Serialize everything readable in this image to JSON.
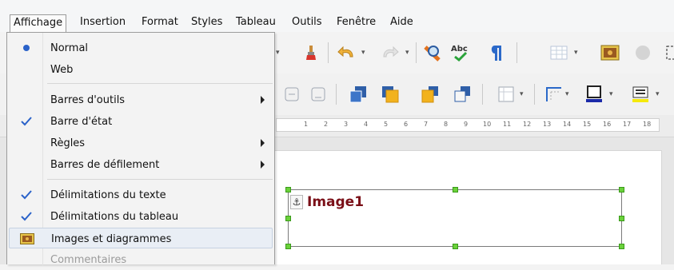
{
  "menubar": {
    "items": [
      "Affichage",
      "Insertion",
      "Format",
      "Styles",
      "Tableau",
      "Outils",
      "Fenêtre",
      "Aide"
    ]
  },
  "menu": {
    "items": [
      {
        "label": "Normal",
        "marker": "radio",
        "submenu": false
      },
      {
        "label": "Web",
        "marker": "none",
        "submenu": false
      },
      {
        "label": "Barres d'outils",
        "marker": "none",
        "submenu": true
      },
      {
        "label": "Barre d'état",
        "marker": "check",
        "submenu": false
      },
      {
        "label": "Règles",
        "marker": "none",
        "submenu": true
      },
      {
        "label": "Barres de défilement",
        "marker": "none",
        "submenu": true
      },
      {
        "label": "Délimitations du texte",
        "marker": "check",
        "submenu": false
      },
      {
        "label": "Délimitations du tableau",
        "marker": "check",
        "submenu": false
      },
      {
        "label": "Images et diagrammes",
        "marker": "image",
        "submenu": false
      },
      {
        "label": "Commentaires",
        "marker": "none",
        "submenu": false
      }
    ]
  },
  "ruler": {
    "marks": [
      "1",
      "2",
      "3",
      "4",
      "5",
      "6",
      "7",
      "8",
      "9",
      "10",
      "11",
      "12",
      "13",
      "14",
      "15",
      "16",
      "17",
      "18"
    ]
  },
  "document": {
    "frame_label": "Image1"
  },
  "colors": {
    "accent_check": "#2a62c9",
    "frame_label": "#7a0f17",
    "handle": "#6ad13a",
    "menu_highlight": "#e9eef5"
  },
  "icons": {
    "toolbar1": [
      "paint-brush-icon",
      "undo-icon",
      "redo-icon",
      "find-icon",
      "spellcheck-icon",
      "formatting-marks-icon",
      "table-icon",
      "image-icon",
      "circle-icon",
      "draw-icon"
    ],
    "toolbar2": [
      "align-icon",
      "align-icon",
      "bring-to-front-icon",
      "send-to-back-icon",
      "forward-one-icon",
      "back-one-icon",
      "properties-icon",
      "border-style-icon",
      "border-color-icon",
      "line-style-icon"
    ]
  }
}
